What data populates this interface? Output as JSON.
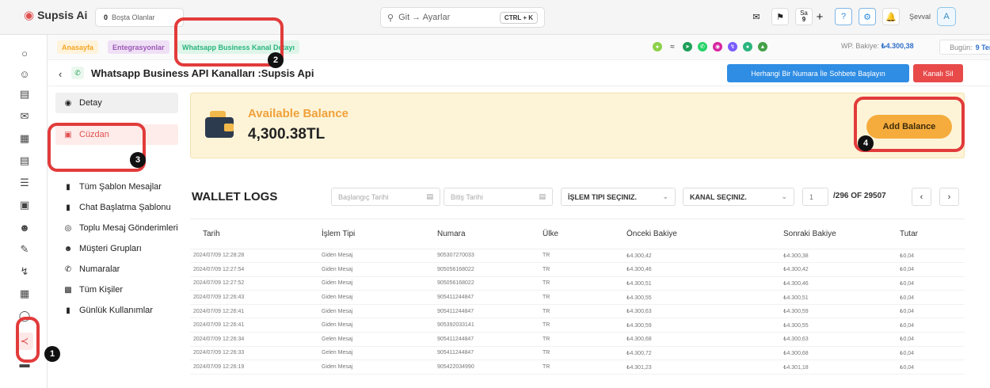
{
  "topbar": {
    "app_name": "Supsis Ai",
    "idle_count": "0",
    "idle_label": "Boşta Olanlar",
    "search_placeholder": "Git → Ayarlar",
    "shortcut": "CTRL + K",
    "counter_label": "Sa",
    "counter_value": "9",
    "user_name": "Şevval",
    "avatar_letter": "A"
  },
  "breadcrumbs": [
    {
      "label": "Anasayfa",
      "color": "#f5a623"
    },
    {
      "label": "Entegrasyonlar",
      "color": "#9b59b6"
    },
    {
      "label": "Whatsapp Business Kanal Detayı",
      "color": "#2ab57d"
    }
  ],
  "subbar": {
    "wp_balance_label": "WP. Bakiye:",
    "wp_balance_value": "₺4.300,38",
    "today_label": "Bugün:",
    "today_value": "9 Tem"
  },
  "page": {
    "title": "Whatsapp Business API Kanalları :Supsis Api",
    "start_chat_button": "Herhangi Bir Numara İle Sohbete Başlayın",
    "delete_channel_button": "Kanalı Sil"
  },
  "menu": [
    {
      "label": "Detay",
      "icon": "info-icon"
    },
    {
      "label": "Cüzdan",
      "icon": "wallet-icon"
    },
    {
      "label": "Tüm Şablon Mesajlar",
      "icon": "document-icon"
    },
    {
      "label": "Chat Başlatma Şablonu",
      "icon": "chat-template-icon"
    },
    {
      "label": "Toplu Mesaj Gönderimleri",
      "icon": "broadcast-icon"
    },
    {
      "label": "Müşteri Grupları",
      "icon": "group-icon"
    },
    {
      "label": "Numaralar",
      "icon": "phone-icon"
    },
    {
      "label": "Tüm Kişiler",
      "icon": "contacts-icon"
    },
    {
      "label": "Günlük Kullanımlar",
      "icon": "usage-icon"
    }
  ],
  "balance": {
    "title": "Available Balance",
    "amount": "4,300.38TL",
    "add_button": "Add Balance"
  },
  "wallet_logs": {
    "title": "WALLET LOGS",
    "start_date_placeholder": "Başlangıç Tarihi",
    "end_date_placeholder": "Bitiş Tarihi",
    "type_select": "İŞLEM TIPI SEÇINIZ.",
    "channel_select": "KANAL SEÇINIZ.",
    "page_value": "1",
    "page_info": "/296 OF 29507",
    "columns": [
      "Tarih",
      "İşlem Tipi",
      "Numara",
      "Ülke",
      "Önceki Bakiye",
      "Sonraki Bakiye",
      "Tutar"
    ],
    "rows": [
      [
        "2024/07/09 12:28:28",
        "Giden Mesaj",
        "905307270033",
        "TR",
        "₺4.300,42",
        "₺4.300,38",
        "₺0,04"
      ],
      [
        "2024/07/09 12:27:54",
        "Giden Mesaj",
        "905056168022",
        "TR",
        "₺4.300,46",
        "₺4.300,42",
        "₺0,04"
      ],
      [
        "2024/07/09 12:27:52",
        "Giden Mesaj",
        "905056168022",
        "TR",
        "₺4.300,51",
        "₺4.300,46",
        "₺0,04"
      ],
      [
        "2024/07/09 12:26:43",
        "Giden Mesaj",
        "905411244847",
        "TR",
        "₺4.300,55",
        "₺4.300,51",
        "₺0,04"
      ],
      [
        "2024/07/09 12:26:41",
        "Giden Mesaj",
        "905411244847",
        "TR",
        "₺4.300,63",
        "₺4.300,59",
        "₺0,04"
      ],
      [
        "2024/07/09 12:26:41",
        "Giden Mesaj",
        "905392033141",
        "TR",
        "₺4.300,59",
        "₺4.300,55",
        "₺0,04"
      ],
      [
        "2024/07/09 12:26:34",
        "Gelen Mesaj",
        "905411244847",
        "TR",
        "₺4.300,68",
        "₺4.300,63",
        "₺0,04"
      ],
      [
        "2024/07/09 12:26:33",
        "Gelen Mesaj",
        "905411244847",
        "TR",
        "₺4.300,72",
        "₺4.300,68",
        "₺0,04"
      ],
      [
        "2024/07/09 12:26:19",
        "Giden Mesaj",
        "905422034990",
        "TR",
        "₺4.301,23",
        "₺4.301,18",
        "₺0,04"
      ]
    ]
  },
  "annotations": [
    "1",
    "2",
    "3",
    "4"
  ]
}
